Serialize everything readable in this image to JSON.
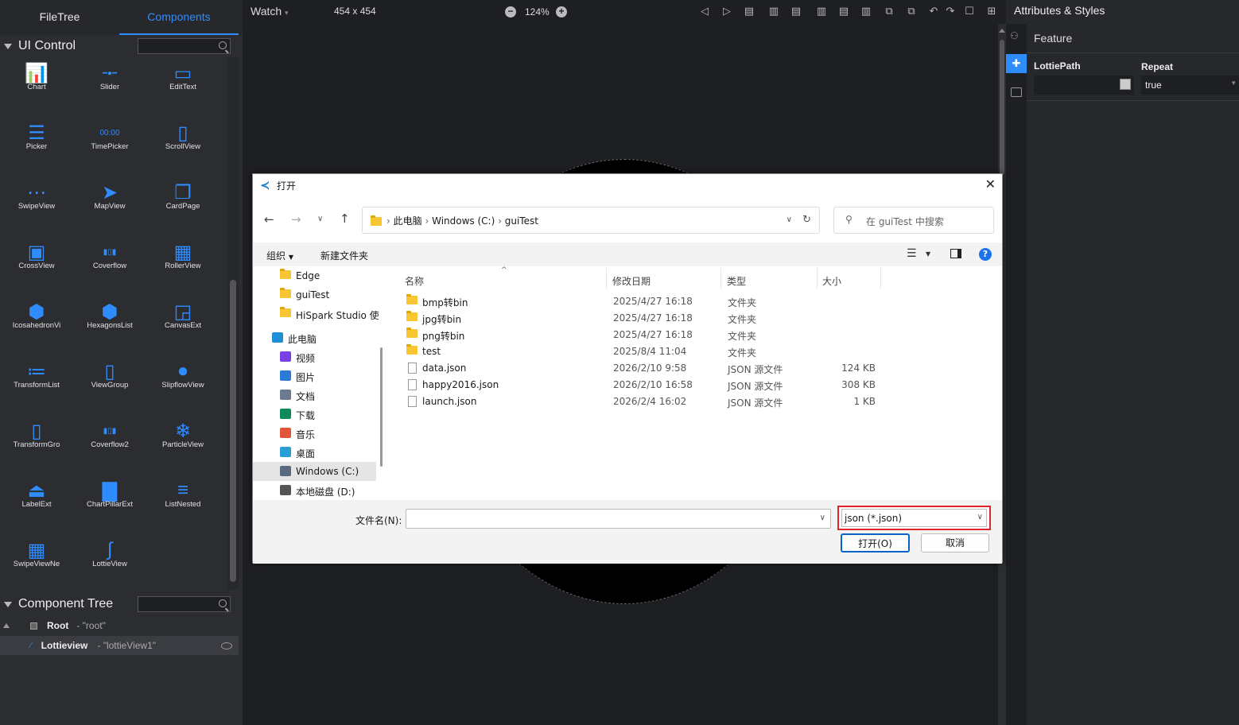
{
  "left": {
    "tabs": [
      "FileTree",
      "Components"
    ],
    "ui_control_title": "UI Control",
    "components": [
      {
        "label": "Chart",
        "icon": "chart-icon"
      },
      {
        "label": "Slider",
        "icon": "slider-icon"
      },
      {
        "label": "EditText",
        "icon": "edittext-icon"
      },
      {
        "label": "Picker",
        "icon": "picker-icon"
      },
      {
        "label": "TimePicker",
        "icon": "timepicker-icon"
      },
      {
        "label": "ScrollView",
        "icon": "scrollview-icon"
      },
      {
        "label": "SwipeView",
        "icon": "swipeview-icon"
      },
      {
        "label": "MapView",
        "icon": "mapview-icon"
      },
      {
        "label": "CardPage",
        "icon": "cardpage-icon"
      },
      {
        "label": "CrossView",
        "icon": "crossview-icon"
      },
      {
        "label": "Coverflow",
        "icon": "coverflow-icon"
      },
      {
        "label": "RollerView",
        "icon": "rollerview-icon"
      },
      {
        "label": "IcosahedronVi",
        "icon": "icosahedron-icon"
      },
      {
        "label": "HexagonsList",
        "icon": "hexagons-icon"
      },
      {
        "label": "CanvasExt",
        "icon": "canvasext-icon"
      },
      {
        "label": "TransformList",
        "icon": "transformlist-icon"
      },
      {
        "label": "ViewGroup",
        "icon": "viewgroup-icon"
      },
      {
        "label": "SlipflowView",
        "icon": "slipflow-icon"
      },
      {
        "label": "TransformGro",
        "icon": "transformgroup-icon"
      },
      {
        "label": "Coverflow2",
        "icon": "coverflow2-icon"
      },
      {
        "label": "ParticleView",
        "icon": "particle-icon"
      },
      {
        "label": "LabelExt",
        "icon": "labelext-icon"
      },
      {
        "label": "ChartPillarExt",
        "icon": "chartpillar-icon"
      },
      {
        "label": "ListNested",
        "icon": "listnested-icon"
      },
      {
        "label": "SwipeViewNe",
        "icon": "swipeviewnested-icon"
      },
      {
        "label": "LottieView",
        "icon": "lottie-icon"
      }
    ],
    "component_tree_title": "Component Tree",
    "tree": [
      {
        "name": "Root",
        "id": "- \"root\""
      },
      {
        "name": "Lottieview",
        "id": "- \"lottieView1\""
      }
    ]
  },
  "toolbar": {
    "watch": "Watch",
    "size": "454 x 454",
    "zoom": "124%"
  },
  "right": {
    "title": "Attributes & Styles",
    "section": "Feature",
    "lottie_path_label": "LottiePath",
    "lottie_path_value": "",
    "repeat_label": "Repeat",
    "repeat_value": "true"
  },
  "dialog": {
    "title": "打开",
    "breadcrumb": [
      "此电脑",
      "Windows (C:)",
      "guiTest"
    ],
    "search_placeholder": "在 guiTest 中搜索",
    "organize": "组织",
    "new_folder": "新建文件夹",
    "columns": [
      "名称",
      "修改日期",
      "类型",
      "大小"
    ],
    "nav": [
      {
        "label": "Edge",
        "kind": "folder"
      },
      {
        "label": "guiTest",
        "kind": "folder"
      },
      {
        "label": "HiSpark Studio 使",
        "kind": "folder"
      },
      {
        "label": "此电脑",
        "kind": "pc"
      },
      {
        "label": "视频",
        "kind": "video"
      },
      {
        "label": "图片",
        "kind": "pic"
      },
      {
        "label": "文档",
        "kind": "doc"
      },
      {
        "label": "下载",
        "kind": "down"
      },
      {
        "label": "音乐",
        "kind": "music"
      },
      {
        "label": "桌面",
        "kind": "desk"
      },
      {
        "label": "Windows (C:)",
        "kind": "drive"
      },
      {
        "label": "本地磁盘 (D:)",
        "kind": "disk"
      }
    ],
    "files": [
      {
        "name": "bmp转bin",
        "date": "2025/4/27 16:18",
        "type": "文件夹",
        "size": "",
        "kind": "folder"
      },
      {
        "name": "jpg转bin",
        "date": "2025/4/27 16:18",
        "type": "文件夹",
        "size": "",
        "kind": "folder"
      },
      {
        "name": "png转bin",
        "date": "2025/4/27 16:18",
        "type": "文件夹",
        "size": "",
        "kind": "folder"
      },
      {
        "name": "test",
        "date": "2025/8/4 11:04",
        "type": "文件夹",
        "size": "",
        "kind": "folder"
      },
      {
        "name": "data.json",
        "date": "2026/2/10 9:58",
        "type": "JSON 源文件",
        "size": "124 KB",
        "kind": "file"
      },
      {
        "name": "happy2016.json",
        "date": "2026/2/10 16:58",
        "type": "JSON 源文件",
        "size": "308 KB",
        "kind": "file"
      },
      {
        "name": "launch.json",
        "date": "2026/2/4 16:02",
        "type": "JSON 源文件",
        "size": "1 KB",
        "kind": "file"
      }
    ],
    "filename_label": "文件名(N):",
    "filename_value": "",
    "filetype": "json (*.json)",
    "open_button": "打开(O)",
    "cancel_button": "取消"
  }
}
